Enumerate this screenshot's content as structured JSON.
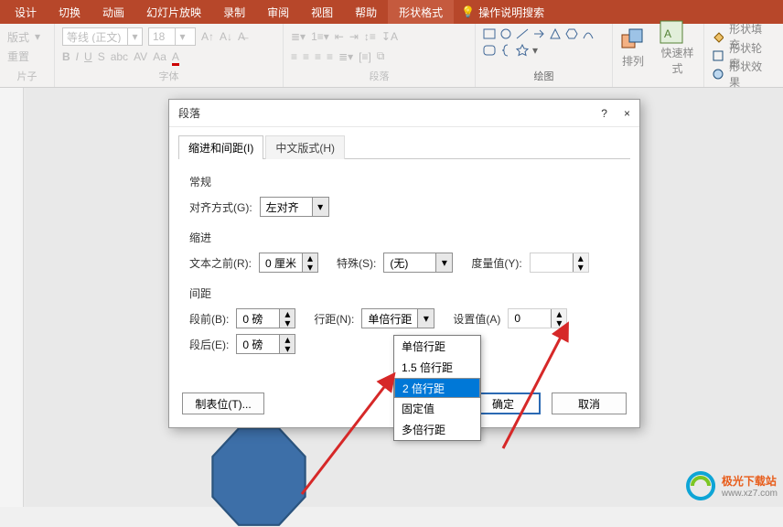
{
  "ribbonTabs": {
    "t0": "设计",
    "t1": "切换",
    "t2": "动画",
    "t3": "幻灯片放映",
    "t4": "录制",
    "t5": "审阅",
    "t6": "视图",
    "t7": "帮助",
    "t8": "形状格式",
    "hint": "操作说明搜索"
  },
  "ribbon": {
    "layout": "版式",
    "reset": "重置",
    "slides": "片子",
    "font": "等线 (正文)",
    "fontSize": "18",
    "fontGroup": "字体",
    "paraGroup": "段落",
    "drawGroup": "绘图",
    "arrange": "排列",
    "quickStyle": "快速样式",
    "shapeFill": "形状填充",
    "shapeOutline": "形状轮廓",
    "shapeEffect": "形状效果"
  },
  "dialog": {
    "title": "段落",
    "help": "?",
    "close": "×",
    "tab1": "缩进和间距(I)",
    "tab2": "中文版式(H)",
    "general": "常规",
    "alignLabel": "对齐方式(G):",
    "alignVal": "左对齐",
    "indent": "缩进",
    "beforeText": "文本之前(R):",
    "beforeTextVal": "0 厘米",
    "special": "特殊(S):",
    "specialVal": "(无)",
    "byLabel": "度量值(Y):",
    "byVal": "",
    "spacing": "间距",
    "before": "段前(B):",
    "beforeVal": "0 磅",
    "after": "段后(E):",
    "afterVal": "0 磅",
    "lineSp": "行距(N):",
    "lineSpVal": "单倍行距",
    "atLabel": "设置值(A)",
    "atVal": "0",
    "tabstops": "制表位(T)...",
    "ok": "确定",
    "cancel": "取消"
  },
  "dropdown": {
    "o1": "单倍行距",
    "o2": "1.5 倍行距",
    "o3": "2 倍行距",
    "o4": "固定值",
    "o5": "多倍行距"
  },
  "watermark": {
    "text": "极光下载站",
    "url": "www.xz7.com"
  }
}
